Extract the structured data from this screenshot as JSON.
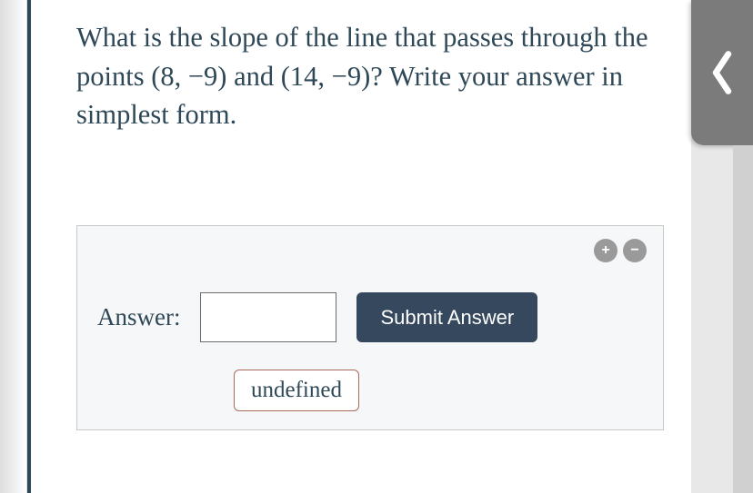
{
  "question": {
    "prefix": "What is the slope of the line that passes through the points ",
    "point1": "(8, −9)",
    "mid": " and ",
    "point2": "(14, −9)",
    "suffix": "? Write your answer in simplest form."
  },
  "answer_area": {
    "label": "Answer:",
    "input_value": "",
    "submit_label": "Submit Answer",
    "undefined_label": "undefined",
    "plus_icon_symbol": "+",
    "minus_icon_symbol": "−"
  }
}
